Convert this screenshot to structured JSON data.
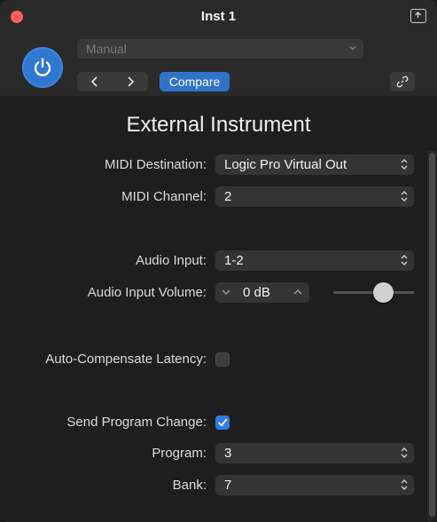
{
  "window": {
    "title": "Inst 1"
  },
  "header": {
    "preset": "Manual",
    "compare_label": "Compare"
  },
  "plugin": {
    "name": "External Instrument"
  },
  "fields": {
    "midi_destination": {
      "label": "MIDI Destination:",
      "value": "Logic Pro Virtual Out"
    },
    "midi_channel": {
      "label": "MIDI Channel:",
      "value": "2"
    },
    "audio_input": {
      "label": "Audio Input:",
      "value": "1-2"
    },
    "audio_input_volume": {
      "label": "Audio Input Volume:",
      "value": "0  dB",
      "slider_level": 0.5
    },
    "auto_compensate_latency": {
      "label": "Auto-Compensate Latency:",
      "checked": false
    },
    "send_program_change": {
      "label": "Send Program Change:",
      "checked": true
    },
    "program": {
      "label": "Program:",
      "value": "3"
    },
    "bank": {
      "label": "Bank:",
      "value": "7"
    }
  },
  "icons": {
    "close": "close-icon",
    "float": "float-window-icon",
    "power": "power-icon",
    "prev": "chevron-left-icon",
    "next": "chevron-right-icon",
    "link": "link-icon",
    "popup": "up-down-chevron-icon"
  },
  "colors": {
    "accent": "#2f72c8",
    "power": "#2f77d0",
    "close": "#ff5f57"
  }
}
